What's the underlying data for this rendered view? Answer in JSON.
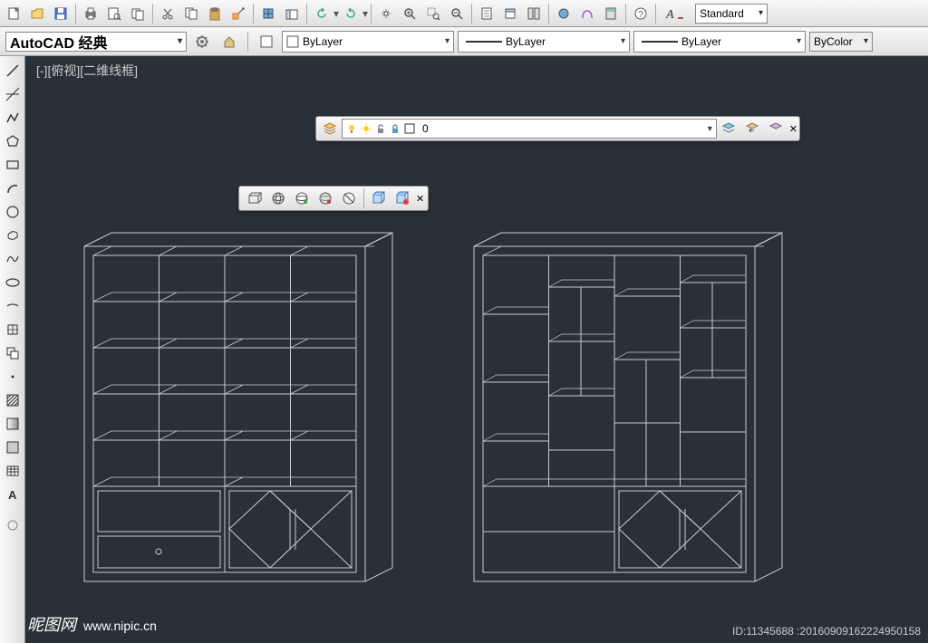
{
  "toolbar_top": {
    "style_dropdown": "Standard"
  },
  "properties": {
    "workspace": "AutoCAD 经典",
    "layer_prop": "ByLayer",
    "linetype_prop": "ByLayer",
    "lineweight_prop": "ByLayer",
    "color_prop": "ByColor"
  },
  "viewport": {
    "label": "[-][俯视][二维线框]"
  },
  "layer_toolbar": {
    "current_layer": "0"
  },
  "watermark": {
    "brand": "昵图网",
    "url": "www.nipic.cn"
  },
  "footer": {
    "id_text": "ID:11345688 :20160909162224950158"
  }
}
